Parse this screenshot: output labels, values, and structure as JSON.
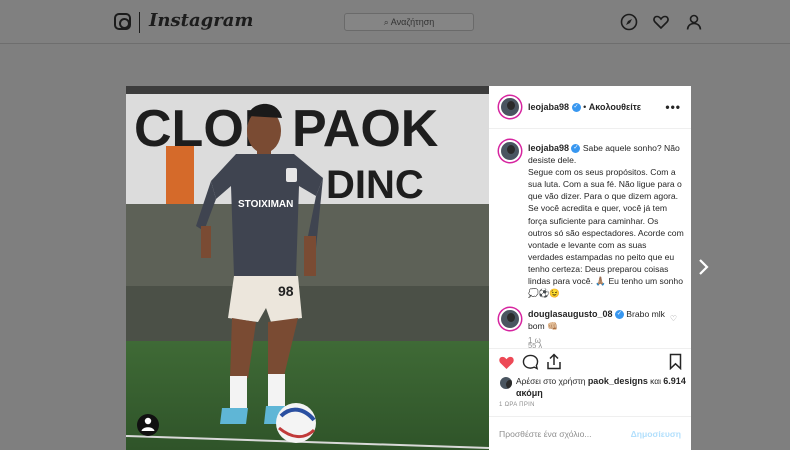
{
  "nav": {
    "logo_text": "Instagram",
    "search_placeholder": "Αναζήτηση"
  },
  "post": {
    "author": "leojaba98",
    "follow_label": "Ακολουθείτε",
    "more_label": "•••",
    "caption_user": "leojaba98",
    "caption_text": "Sabe aquele sonho? Não desiste dele.\nSegue com os seus propósitos. Com a sua luta. Com a sua fé. Não ligue para o que vão dizer. Para o que dizem agora. Se você acredita e quer, você já tem força suficiente para caminhar. Os outros só são espectadores. Acorde com vontade e levante com as suas verdades estampadas no peito que eu tenho certeza: Deus preparou coisas lindas para você. 🙏🏽 Eu tenho um sonho 💭⚽😉",
    "caption_time": "1 ω",
    "comment": {
      "user": "douglasaugusto_08",
      "text": "Brabo mlk bom 👊🏼",
      "meta": "55 λ"
    },
    "likes": {
      "prefix": "Αρέσει στο χρήστη",
      "user": "paok_designs",
      "middle": "και",
      "count": "6.914 ακόμη"
    },
    "time_ago": "1 ΩΡΑ ΠΡΙΝ",
    "add_comment_placeholder": "Προσθέστε ένα σχόλιο...",
    "post_label": "Δημοσίευση"
  },
  "photo": {
    "banner_text": "CLOP PAOK",
    "banner_text2": "DINC",
    "sponsor": "STOIXIMAN",
    "shirt_number": "98"
  },
  "colors": {
    "like_red": "#ed4956",
    "verified_blue": "#3897f0",
    "post_button": "#b2dffc"
  }
}
